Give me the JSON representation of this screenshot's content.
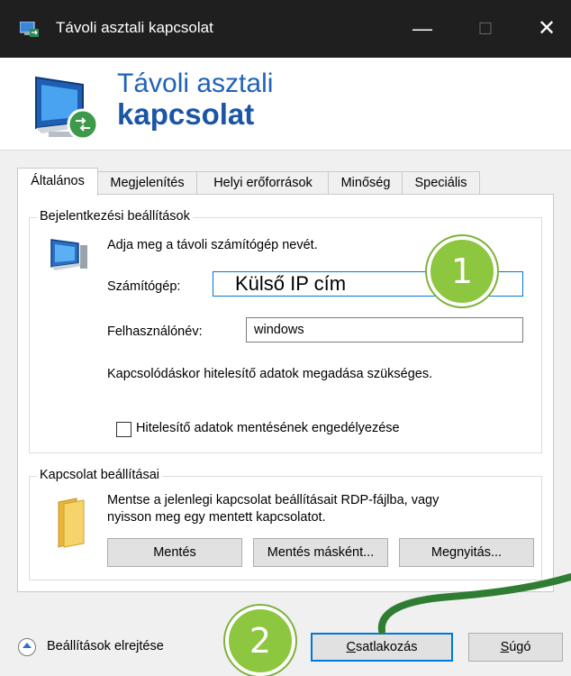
{
  "window": {
    "title": "Távoli asztali kapcsolat",
    "minimize_glyph": "—",
    "maximize_glyph": "☐",
    "close_glyph": "✕"
  },
  "banner": {
    "line1": "Távoli asztali",
    "line2": "kapcsolat"
  },
  "tabs": [
    {
      "label": "Általános",
      "active": true
    },
    {
      "label": "Megjelenítés",
      "active": false
    },
    {
      "label": "Helyi erőforrások",
      "active": false
    },
    {
      "label": "Minőség",
      "active": false
    },
    {
      "label": "Speciális",
      "active": false
    }
  ],
  "login_group": {
    "title": "Bejelentkezési beállítások",
    "hint": "Adja meg a távoli számítógép nevét.",
    "computer_label": "Számítógép:",
    "computer_value": "Külső IP cím",
    "username_label": "Felhasználónév:",
    "username_value": "windows",
    "credentials_note": "Kapcsolódáskor hitelesítő adatok megadása szükséges.",
    "save_credentials_label": "Hitelesítő adatok mentésének engedélyezése",
    "save_credentials_checked": false
  },
  "connection_group": {
    "title": "Kapcsolat beállításai",
    "description_line1": "Mentse a jelenlegi kapcsolat beállításait RDP-fájlba, vagy",
    "description_line2": "nyisson meg egy mentett kapcsolatot.",
    "save_button": "Mentés",
    "save_as_button": "Mentés másként...",
    "open_button": "Megnyitás..."
  },
  "footer": {
    "hide_options_label": "Beállítások elrejtése",
    "connect_button_accel": "C",
    "connect_button_rest": "satlakozás",
    "help_button_accel": "S",
    "help_button_rest": "úgó"
  },
  "annotations": {
    "badge1": "1",
    "badge2": "2",
    "color": "#8dc63f",
    "arrow_color": "#2e7d32"
  }
}
